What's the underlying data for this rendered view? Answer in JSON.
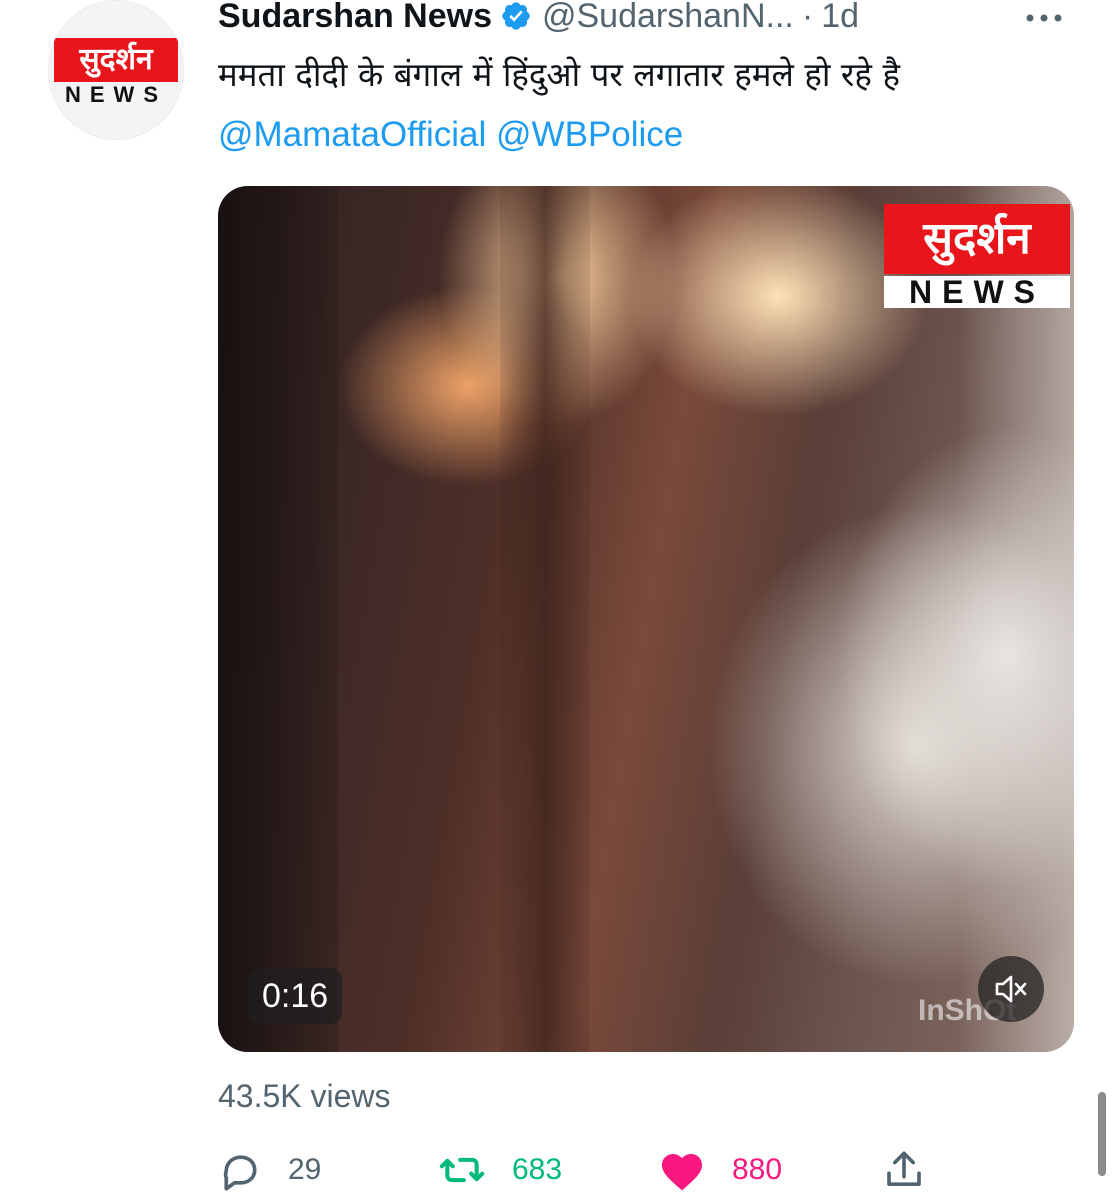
{
  "author": {
    "name": "Sudarshan News",
    "handle": "@SudarshanN...",
    "separator": "·",
    "timestamp": "1d",
    "verified": true,
    "avatar_logo_top": "सुदर्शन",
    "avatar_logo_bottom": "NEWS"
  },
  "tweet": {
    "text": "ममता दीदी के बंगाल में हिंदुओ पर लगातार हमले हो रहे है",
    "mentions": [
      "@MamataOfficial",
      "@WBPolice"
    ]
  },
  "media": {
    "duration": "0:16",
    "watermark_top": "सुदर्शन",
    "watermark_bottom": "NEWS",
    "app_watermark": "InShOt"
  },
  "stats": {
    "views_label": "43.5K views"
  },
  "actions": {
    "reply_count": "29",
    "retweet_count": "683",
    "like_count": "880"
  },
  "colors": {
    "accent": "#1d9bf0",
    "retweet": "#00ba7c",
    "like": "#f91880",
    "muted_text": "#536471",
    "brand_red": "#e8151b"
  },
  "icons": {
    "verified": "verified-badge-icon",
    "more": "more-horizontal-icon",
    "mute": "volume-muted-icon",
    "reply": "reply-bubble-icon",
    "retweet": "retweet-icon",
    "like": "heart-filled-icon",
    "share": "share-upload-icon"
  }
}
